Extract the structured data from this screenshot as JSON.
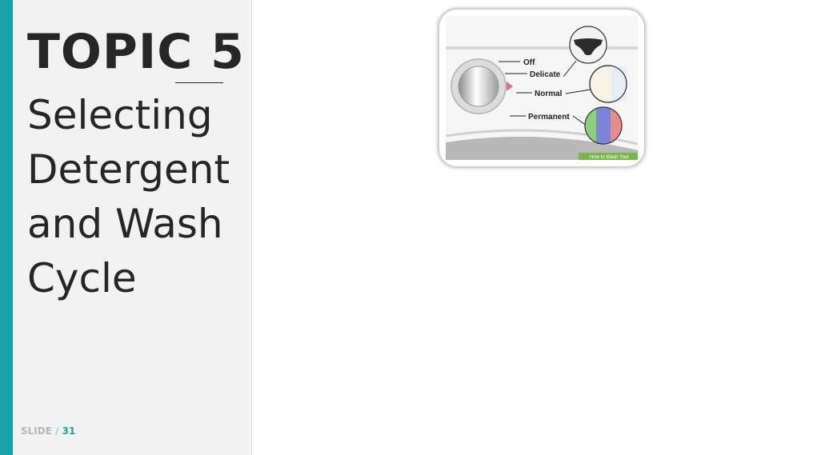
{
  "slide": {
    "topic_label": "TOPIC 5",
    "subtitle": "Selecting Detergent and Wash Cycle",
    "footer_label": "SLIDE",
    "footer_separator": " / ",
    "footer_number": "31"
  },
  "illustration": {
    "labels": {
      "off": "Off",
      "delicate": "Delicate",
      "normal": "Normal",
      "permanent": "Permanent"
    },
    "caption": "How to Wash Your"
  },
  "colors": {
    "accent": "#17a3a6",
    "panel": "#f2f2f2",
    "text": "#262626"
  }
}
